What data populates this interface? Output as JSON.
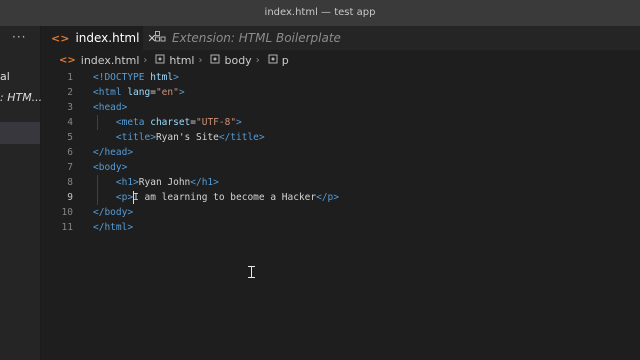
{
  "window": {
    "title": "index.html — test app"
  },
  "activity_bar": {
    "more_glyph": "···",
    "fragment1": "al",
    "fragment2": ": HTM..."
  },
  "tabs": [
    {
      "label": "index.html",
      "icon": "html-file-icon",
      "active": true,
      "close_glyph": "✕"
    },
    {
      "label": "Extension: HTML Boilerplate",
      "icon": "extensions-icon",
      "active": false
    }
  ],
  "breadcrumb": {
    "file": "index.html",
    "items": [
      "html",
      "body",
      "p"
    ],
    "separator": "›"
  },
  "editor": {
    "current_line": 9,
    "line_numbers": [
      "1",
      "2",
      "3",
      "4",
      "5",
      "6",
      "7",
      "8",
      "9",
      "10",
      "11"
    ],
    "lines": [
      {
        "indent": "",
        "tokens": [
          {
            "t": "tag",
            "v": "<!DOCTYPE"
          },
          {
            "t": "attr",
            "v": " html"
          },
          {
            "t": "tag",
            "v": ">"
          }
        ]
      },
      {
        "indent": "",
        "tokens": [
          {
            "t": "tag",
            "v": "<html"
          },
          {
            "t": "attr",
            "v": " lang"
          },
          {
            "t": "txt",
            "v": "="
          },
          {
            "t": "str",
            "v": "\"en\""
          },
          {
            "t": "tag",
            "v": ">"
          }
        ]
      },
      {
        "indent": "",
        "tokens": [
          {
            "t": "tag",
            "v": "<head>"
          }
        ]
      },
      {
        "indent": "    ",
        "tokens": [
          {
            "t": "tag",
            "v": "<meta"
          },
          {
            "t": "attr",
            "v": " charset"
          },
          {
            "t": "txt",
            "v": "="
          },
          {
            "t": "str",
            "v": "\"UTF-8\""
          },
          {
            "t": "tag",
            "v": ">"
          }
        ]
      },
      {
        "indent": "    ",
        "tokens": [
          {
            "t": "tag",
            "v": "<title>"
          },
          {
            "t": "txt",
            "v": "Ryan's Site"
          },
          {
            "t": "tag",
            "v": "</title>"
          }
        ]
      },
      {
        "indent": "",
        "tokens": [
          {
            "t": "tag",
            "v": "</head>"
          }
        ]
      },
      {
        "indent": "",
        "tokens": [
          {
            "t": "tag",
            "v": "<body>"
          }
        ]
      },
      {
        "indent": "    ",
        "tokens": [
          {
            "t": "tag",
            "v": "<h1>"
          },
          {
            "t": "txt",
            "v": "Ryan John"
          },
          {
            "t": "tag",
            "v": "</h1>"
          }
        ]
      },
      {
        "indent": "    ",
        "tokens": [
          {
            "t": "tag",
            "v": "<p>"
          },
          {
            "t": "txt",
            "v": "I am learning to become a Hacker"
          },
          {
            "t": "tag",
            "v": "</p>"
          }
        ]
      },
      {
        "indent": "",
        "tokens": [
          {
            "t": "tag",
            "v": "</body>"
          }
        ]
      },
      {
        "indent": "",
        "tokens": [
          {
            "t": "tag",
            "v": "</html>"
          }
        ]
      }
    ]
  },
  "colors": {
    "tag": "#569cd6",
    "attr": "#9cdcfe",
    "string": "#ce9178",
    "text": "#d4d4d4",
    "editor_bg": "#1e1e1e",
    "html_icon": "#e37933"
  }
}
